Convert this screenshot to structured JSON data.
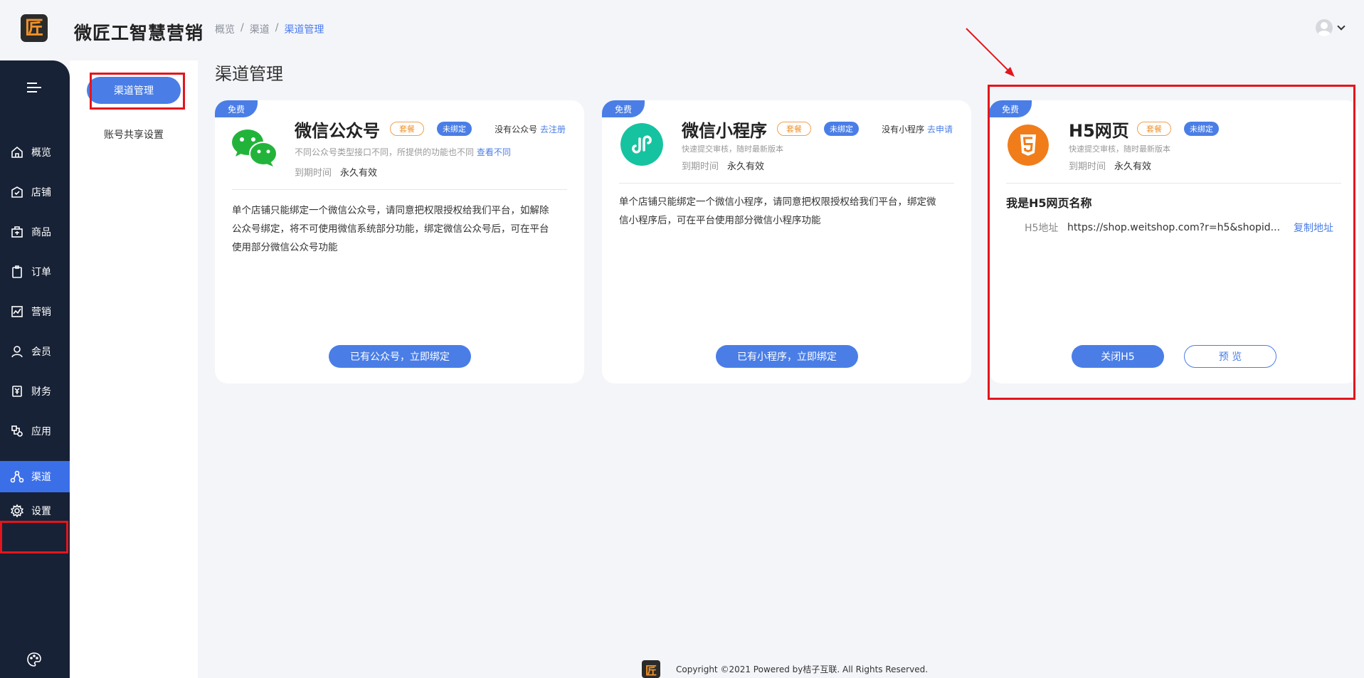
{
  "app": {
    "brand": "微匠工智慧营销",
    "logo_glyph": "匠"
  },
  "breadcrumb": [
    "概览",
    "渠道",
    "渠道管理"
  ],
  "breadcrumb_sep": "/",
  "sidebar": {
    "items": [
      {
        "label": "概览",
        "icon": "home-icon"
      },
      {
        "label": "店铺",
        "icon": "shop-icon"
      },
      {
        "label": "商品",
        "icon": "goods-icon"
      },
      {
        "label": "订单",
        "icon": "order-icon"
      },
      {
        "label": "营销",
        "icon": "marketing-icon"
      },
      {
        "label": "会员",
        "icon": "member-icon"
      },
      {
        "label": "财务",
        "icon": "finance-icon"
      },
      {
        "label": "应用",
        "icon": "apps-icon"
      },
      {
        "label": "渠道",
        "icon": "channel-icon",
        "active": true
      },
      {
        "label": "设置",
        "icon": "gear-icon"
      }
    ]
  },
  "subnav": {
    "active": "渠道管理",
    "other": "账号共享设置"
  },
  "page_title": "渠道管理",
  "cards": {
    "wechat": {
      "tag": "免费",
      "title": "微信公众号",
      "plan": "套餐",
      "status": "未绑定",
      "side_text": "没有公众号",
      "side_link": "去注册",
      "sub_text": "不同公众号类型接口不同，所提供的功能也不同",
      "sub_link": "查看不同",
      "expire_label": "到期时间",
      "expire_value": "永久有效",
      "desc_lines": [
        "单个店铺只能绑定一个微信公众号，请同意把权限授权给我们平台，如解除",
        "公众号绑定，将不可使用微信系统部分功能，绑定微信公众号后，可在平台",
        "使用部分微信公众号功能"
      ],
      "button": "已有公众号，立即绑定"
    },
    "mini": {
      "tag": "免费",
      "title": "微信小程序",
      "plan": "套餐",
      "status": "未绑定",
      "side_text": "没有小程序",
      "side_link": "去申请",
      "sub_text": "快速提交审核，随时最新版本",
      "expire_label": "到期时间",
      "expire_value": "永久有效",
      "desc_lines": [
        "单个店铺只能绑定一个微信小程序，请同意把权限授权给我们平台，绑定微",
        "信小程序后，可在平台使用部分微信小程序功能"
      ],
      "button": "已有小程序，立即绑定"
    },
    "h5": {
      "tag": "免费",
      "title": "H5网页",
      "plan": "套餐",
      "status": "未绑定",
      "sub_text": "快速提交审核，随时最新版本",
      "expire_label": "到期时间",
      "expire_value": "永久有效",
      "name": "我是H5网页名称",
      "addr_label": "H5地址",
      "addr_value": "https://shop.weitshop.com?r=h5&shopid...",
      "copy": "复制地址",
      "close_button": "关闭H5",
      "preview_button": "预 览"
    }
  },
  "footer": {
    "text": "Copyright ©2021 Powered by桔子互联. All Rights Reserved."
  },
  "colors": {
    "accent": "#4a7ee6",
    "sidebar": "#172236",
    "highlight": "#e4151c",
    "wechat": "#22b43a",
    "mini": "#16c3a0",
    "h5": "#f07d1a"
  }
}
